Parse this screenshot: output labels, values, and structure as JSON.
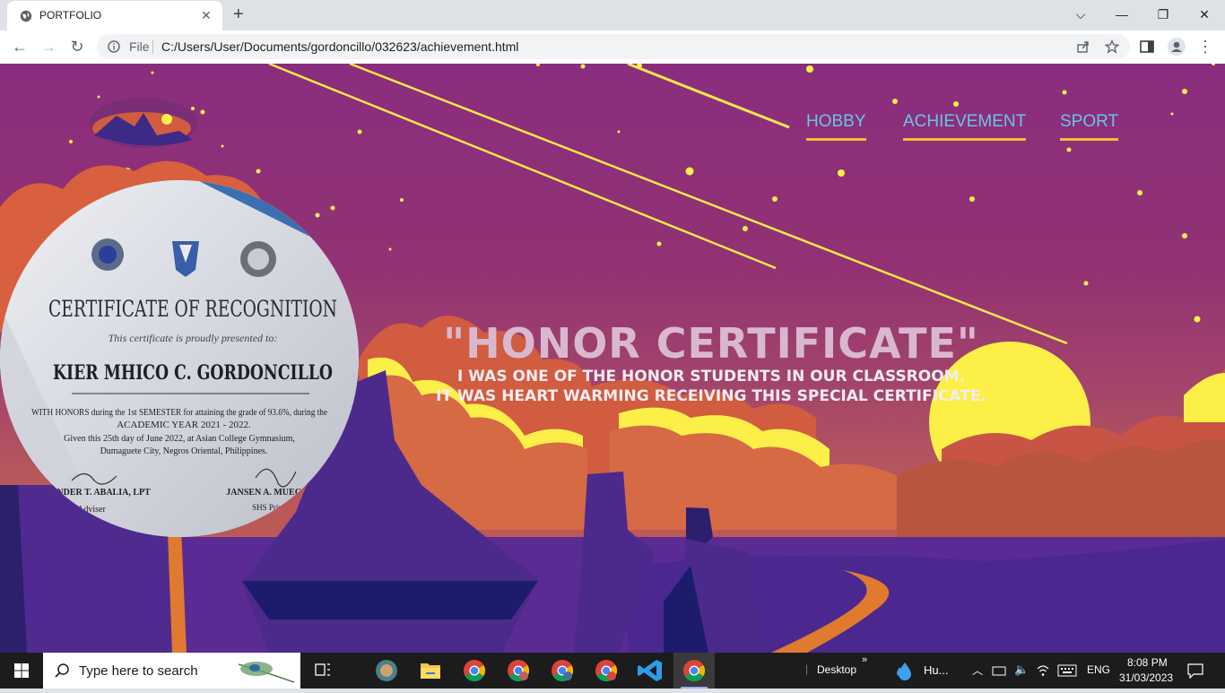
{
  "browser": {
    "tab_title": "PORTFOLIO",
    "address_scheme": "File",
    "address_url": "C:/Users/User/Documents/gordoncillo/032623/achievement.html"
  },
  "nav": {
    "links": [
      "HOBBY",
      "ACHIEVEMENT",
      "SPORT"
    ]
  },
  "hero": {
    "title": "\"HONOR CERTIFICATE\"",
    "line1": "I WAS ONE OF THE HONOR STUDENTS IN OUR CLASSROOM.",
    "line2": "IT WAS HEART WARMING RECEIVING THIS SPECIAL CERTIFICATE."
  },
  "certificate": {
    "heading": "CERTIFICATE OF RECOGNITION",
    "intro": "This certificate is proudly presented to:",
    "recipient": "KIER MHICO C. GORDONCILLO",
    "body1": "WITH HONORS during the 1st SEMESTER for attaining the grade of 93.6%, during the",
    "body2": "ACADEMIC YEAR 2021 - 2022.",
    "body3": "Given this 25th day of June 2022, at Asian College Gymnasium,",
    "body4": "Dumaguete City, Negros Oriental, Philippines.",
    "sig_left_name": "ANDER T. ABALIA, LPT",
    "sig_left_role": "Adviser",
    "sig_right_name": "JANSEN A. MUECO",
    "sig_right_role": "SHS Prin"
  },
  "taskbar": {
    "search_placeholder": "Type here to search",
    "desktop_label": "Desktop",
    "weather_label": "Hu...",
    "language": "ENG",
    "time": "8:08 PM",
    "date": "31/03/2023"
  },
  "colors": {
    "nav_link": "#67c5e7",
    "nav_underline": "#f1c128",
    "sun": "#fbef48",
    "sky_top": "#8a2d7e"
  }
}
